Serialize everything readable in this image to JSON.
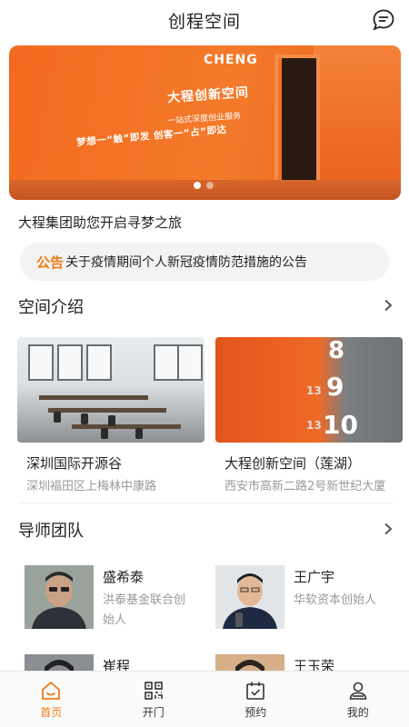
{
  "header": {
    "title": "创程空间"
  },
  "banner": {
    "brand": "CHENG",
    "headline": "大程创新空间",
    "tagline": "一站式深度创业服务",
    "slogan": "梦想一“触”即发  创客一“占”即达",
    "slide_index": 1,
    "slide_count": 2
  },
  "intro": "大程集团助您开启寻梦之旅",
  "notice": {
    "tag": "公告",
    "text": "关于疫情期间个人新冠疫情防范措施的公告"
  },
  "spaces": {
    "title": "空间介绍",
    "items": [
      {
        "name": "深圳国际开源谷",
        "address": "深圳福田区上梅林中康路"
      },
      {
        "name": "大程创新空间（莲湖）",
        "address": "西安市高新二路2号新世纪大厦"
      }
    ],
    "room_numbers": [
      "8",
      "9",
      "10",
      "13",
      "13"
    ]
  },
  "mentors": {
    "title": "导师团队",
    "items": [
      {
        "name": "盛希泰",
        "desc": "洪泰基金联合创始人"
      },
      {
        "name": "王广宇",
        "desc": "华软资本创始人"
      },
      {
        "name": "崔程",
        "desc": ""
      },
      {
        "name": "王玉荣",
        "desc": ""
      }
    ]
  },
  "tabbar": {
    "items": [
      {
        "label": "首页",
        "icon": "home-icon"
      },
      {
        "label": "开门",
        "icon": "qr-code-icon"
      },
      {
        "label": "预约",
        "icon": "calendar-check-icon"
      },
      {
        "label": "我的",
        "icon": "user-icon"
      }
    ]
  },
  "colors": {
    "accent": "#f07a14",
    "banner": "#f26a1f"
  }
}
